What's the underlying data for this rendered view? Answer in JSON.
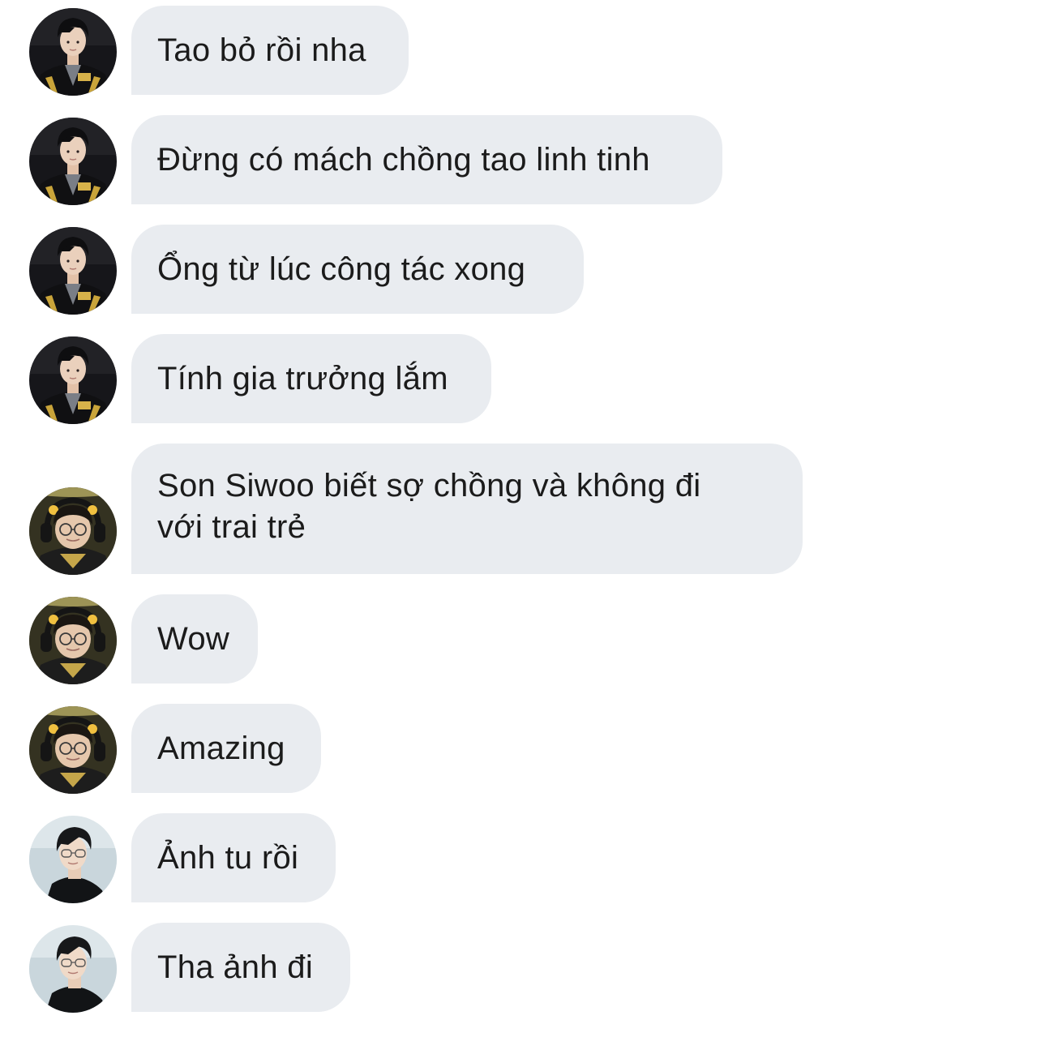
{
  "messages": [
    {
      "sender": "a",
      "text": "Tao bỏ rồi nha"
    },
    {
      "sender": "a",
      "text": "Đừng có mách chồng tao linh tinh"
    },
    {
      "sender": "a",
      "text": "Ổng từ lúc công tác xong"
    },
    {
      "sender": "a",
      "text": "Tính gia trưởng lắm"
    },
    {
      "sender": "b",
      "text_line1": "Son Siwoo biết sợ chồng và không đi",
      "text_line2": "với trai trẻ"
    },
    {
      "sender": "b",
      "text": "Wow"
    },
    {
      "sender": "b",
      "text": "Amazing"
    },
    {
      "sender": "c",
      "text": "Ảnh tu rồi"
    },
    {
      "sender": "c",
      "text": "Tha ảnh đi"
    }
  ],
  "colors": {
    "bubble": "#e9ecf0",
    "text": "#1b1b1b",
    "background": "#ffffff"
  }
}
